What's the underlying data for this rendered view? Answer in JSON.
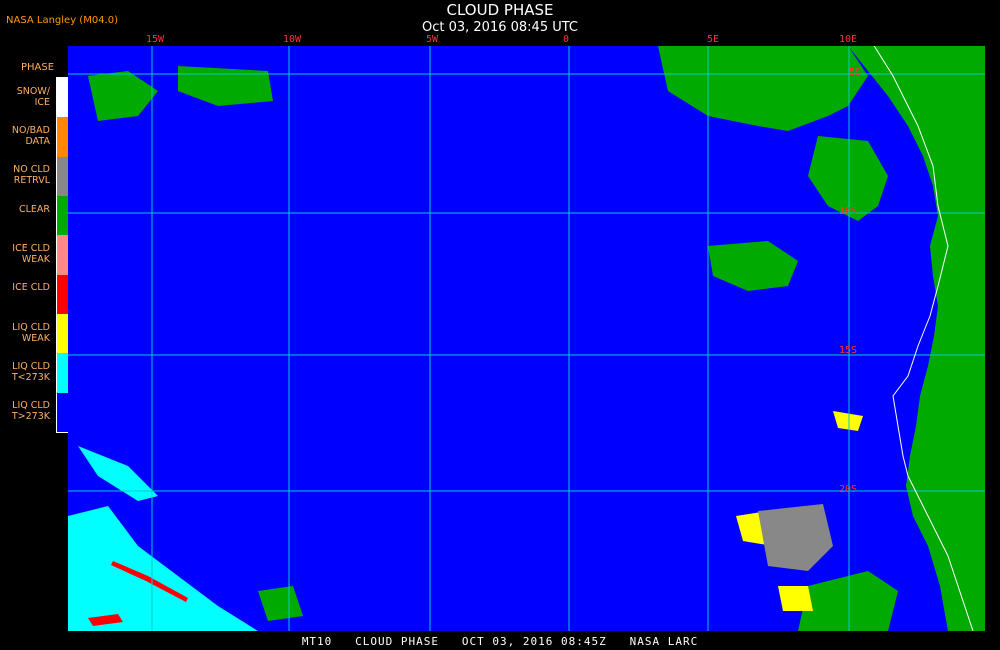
{
  "header": {
    "source": "NASA Langley (M04.0)",
    "title": "CLOUD PHASE",
    "datetime": "Oct 03, 2016 08:45 UTC"
  },
  "legend": {
    "title": "PHASE",
    "items": [
      {
        "label": "SNOW/\nICE",
        "color": "#ffffff"
      },
      {
        "label": "NO/BAD\nDATA",
        "color": "#ff8800"
      },
      {
        "label": "NO CLD\nRETRVL",
        "color": "#888888"
      },
      {
        "label": "CLEAR",
        "color": "#00aa00"
      },
      {
        "label": "ICE CLD\nWEAK",
        "color": "#ff8888"
      },
      {
        "label": "ICE CLD",
        "color": "#ff0000"
      },
      {
        "label": "LIQ CLD\nWEAK",
        "color": "#ffff00"
      },
      {
        "label": "LIQ CLD\nT<273K",
        "color": "#00ffff"
      },
      {
        "label": "LIQ CLD\nT>273K",
        "color": "#0000ff"
      }
    ]
  },
  "map": {
    "lon_ticks": [
      "15W",
      "10W",
      "5W",
      "0",
      "5E",
      "10E"
    ],
    "lat_ticks": [
      "5S",
      "10S",
      "15S",
      "20S"
    ],
    "colors": {
      "ocean": "#0000ff",
      "land": "#00aa00",
      "grid": "#00cccc",
      "coast": "#ffffff"
    }
  },
  "footer": {
    "text": "MT10   CLOUD PHASE   OCT 03, 2016 08:45Z   NASA LARC"
  }
}
